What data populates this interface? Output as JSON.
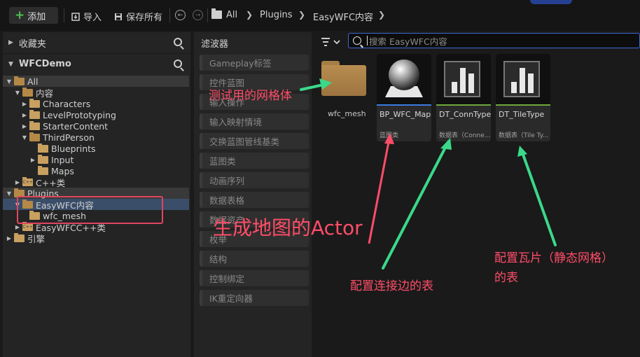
{
  "toolbar": {
    "add_label": "添加",
    "import_label": "导入",
    "save_all_label": "保存所有",
    "breadcrumbs": [
      "All",
      "Plugins",
      "EasyWFC内容"
    ]
  },
  "sidebar": {
    "favorites_label": "收藏夹",
    "project_label": "WFCDemo",
    "tree": {
      "all": "All",
      "content": "内容",
      "characters": "Characters",
      "level_prototyping": "LevelPrototyping",
      "starter_content": "StarterContent",
      "third_person": "ThirdPerson",
      "blueprints": "Blueprints",
      "input": "Input",
      "maps": "Maps",
      "cpp_classes": "C++类",
      "plugins": "Plugins",
      "easywfc_content": "EasyWFC内容",
      "wfc_mesh": "wfc_mesh",
      "easywfc_cpp": "EasyWFCC++类",
      "engine": "引擎"
    }
  },
  "filters": {
    "title": "滤波器",
    "items": [
      "Gameplay标签",
      "控件蓝图",
      "输入操作",
      "输入映射情境",
      "交换蓝图管线基类",
      "蓝图类",
      "动画序列",
      "数据表格",
      "数据资产",
      "枚举",
      "结构",
      "控制绑定",
      "IK重定向器"
    ]
  },
  "search": {
    "placeholder": "搜索 EasyWFC内容"
  },
  "assets": {
    "folder_name": "wfc_mesh",
    "bp_name": "BP_WFC_Map",
    "bp_type": "蓝图类",
    "conn_name": "DT_ConnType",
    "conn_type": "数据表（Conne...",
    "tile_name": "DT_TileType",
    "tile_type": "数据表（Tile Ty..."
  },
  "annotations": {
    "mesh_note": "测试用的网格体",
    "actor_note": "生成地图的Actor",
    "conn_note": "配置连接边的表",
    "tile_note_line1": "配置瓦片（静态网格）",
    "tile_note_line2": "的表"
  },
  "colors": {
    "annotation_red": "#ff4d68",
    "arrow_green": "#3ad98a",
    "selection_box": "#e0455f",
    "search_border": "#3d6bd6",
    "bp_stripe": "#3b7ae0",
    "datatable_stripe": "#6fa83a"
  }
}
